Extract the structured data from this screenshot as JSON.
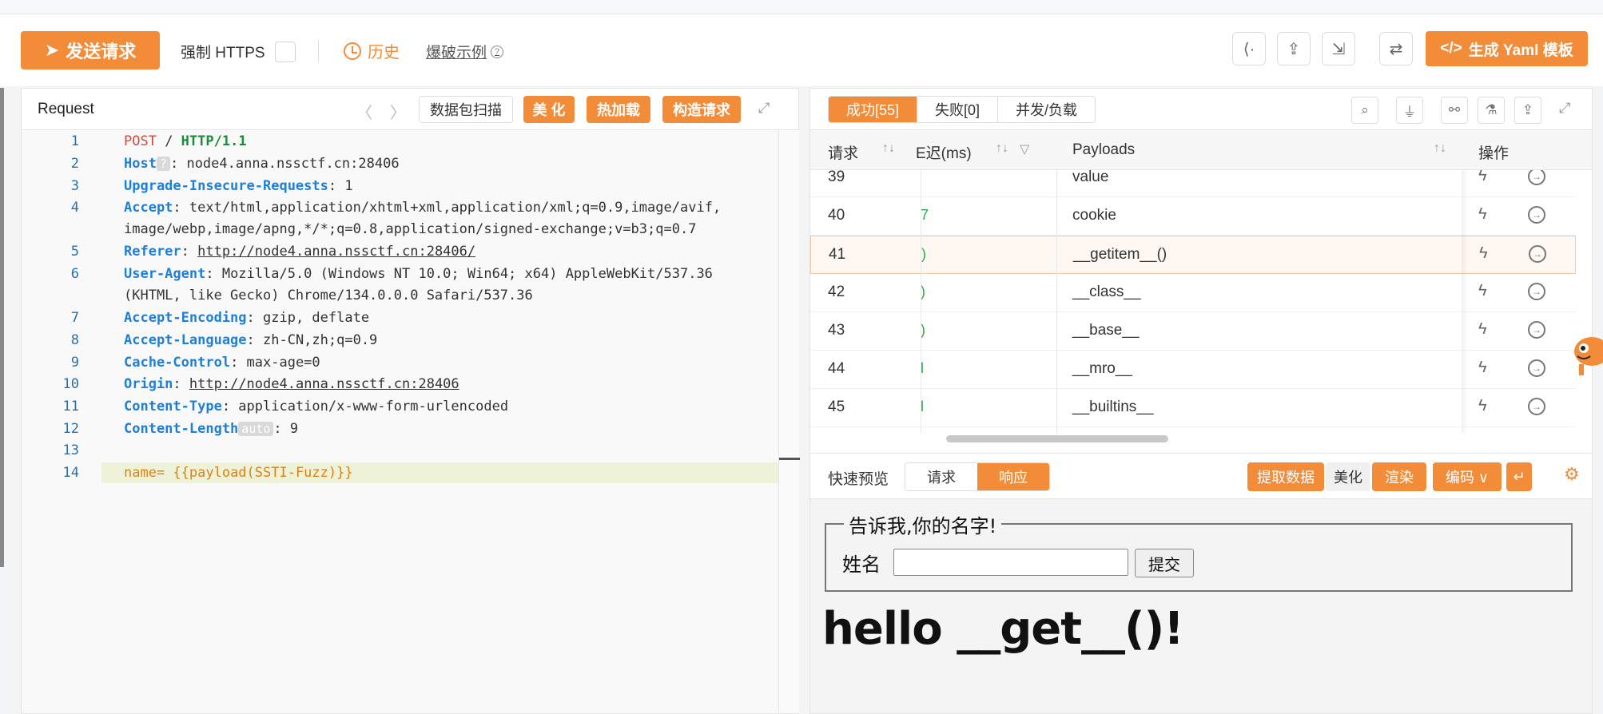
{
  "toolbar": {
    "send_label": "发送请求",
    "https_label": "强制 HTTPS",
    "history_label": "历史",
    "example_label": "爆破示例",
    "yaml_label": "生成 Yaml 模板",
    "right_icons": [
      "share-icon",
      "export-icon",
      "import-icon",
      "swap-icon"
    ]
  },
  "request": {
    "title": "Request",
    "scan_label": "数据包扫描",
    "beautify_label": "美 化",
    "hotload_label": "热加载",
    "build_label": "构造请求",
    "lines": [
      {
        "n": "1"
      },
      {
        "n": "2"
      },
      {
        "n": "3"
      },
      {
        "n": "4"
      },
      {
        "n": ""
      },
      {
        "n": "5"
      },
      {
        "n": "6"
      },
      {
        "n": ""
      },
      {
        "n": "7"
      },
      {
        "n": "8"
      },
      {
        "n": "9"
      },
      {
        "n": "10"
      },
      {
        "n": "11"
      },
      {
        "n": "12"
      },
      {
        "n": "13"
      },
      {
        "n": "14"
      }
    ],
    "method": "POST",
    "path": " / ",
    "version": "HTTP/1.1",
    "h_host_key": "Host",
    "h_host_badge": "?",
    "h_host_val": ": node4.anna.nssctf.cn:28406",
    "h_upg_key": "Upgrade-Insecure-Requests",
    "h_upg_val": ": 1",
    "h_accept_key": "Accept",
    "h_accept_val": ": text/html,application/xhtml+xml,application/xml;q=0.9,image/avif,",
    "h_accept_val2": "image/webp,image/apng,*/*;q=0.8,application/signed-exchange;v=b3;q=0.7",
    "h_ref_key": "Referer",
    "h_ref_val": "http://node4.anna.nssctf.cn:28406/",
    "h_ua_key": "User-Agent",
    "h_ua_val": ": Mozilla/5.0 (Windows NT 10.0; Win64; x64) AppleWebKit/537.36",
    "h_ua_val2": "(KHTML, like Gecko) Chrome/134.0.0.0 Safari/537.36",
    "h_enc_key": "Accept-Encoding",
    "h_enc_val": ": gzip, deflate",
    "h_lang_key": "Accept-Language",
    "h_lang_val": ": zh-CN,zh;q=0.9",
    "h_cache_key": "Cache-Control",
    "h_cache_val": ": max-age=0",
    "h_origin_key": "Origin",
    "h_origin_val": "http://node4.anna.nssctf.cn:28406",
    "h_ct_key": "Content-Type",
    "h_ct_val": ": application/x-www-form-urlencoded",
    "h_cl_key": "Content-Length",
    "h_cl_badge": "auto",
    "h_cl_val": ": 9",
    "body_key": "name",
    "body_val": "= {{payload(SSTI-Fuzz)}}"
  },
  "results": {
    "tab_success": "成功[55]",
    "tab_fail": "失败[0]",
    "tab_concurrency": "并发/负载",
    "col_request": "请求",
    "col_delay": "E迟(ms)",
    "col_payloads": "Payloads",
    "col_action": "操作",
    "rows": [
      {
        "req": "39",
        "delay": "",
        "payload": "value"
      },
      {
        "req": "40",
        "delay": "7",
        "payload": "cookie"
      },
      {
        "req": "41",
        "delay": ")",
        "payload": "__getitem__()"
      },
      {
        "req": "42",
        "delay": ")",
        "payload": "__class__"
      },
      {
        "req": "43",
        "delay": ")",
        "payload": "__base__"
      },
      {
        "req": "44",
        "delay": "l",
        "payload": "__mro__"
      },
      {
        "req": "45",
        "delay": "l",
        "payload": "__builtins__"
      }
    ],
    "selected_row": "41"
  },
  "quick_preview": {
    "title": "快速预览",
    "tab_request": "请求",
    "tab_response": "响应",
    "extract_label": "提取数据",
    "beautify_label": "美化",
    "render_label": "渲染",
    "encode_label": "编码 ∨"
  },
  "rendered_page": {
    "legend": "告诉我,你的名字!",
    "name_label": "姓名",
    "submit_label": "提交",
    "hello_text": "hello __get__()!"
  },
  "colors": {
    "accent": "#f28c38",
    "header_key": "#1e7fd6",
    "method": "#d14a42",
    "version": "#1a8c3c"
  }
}
